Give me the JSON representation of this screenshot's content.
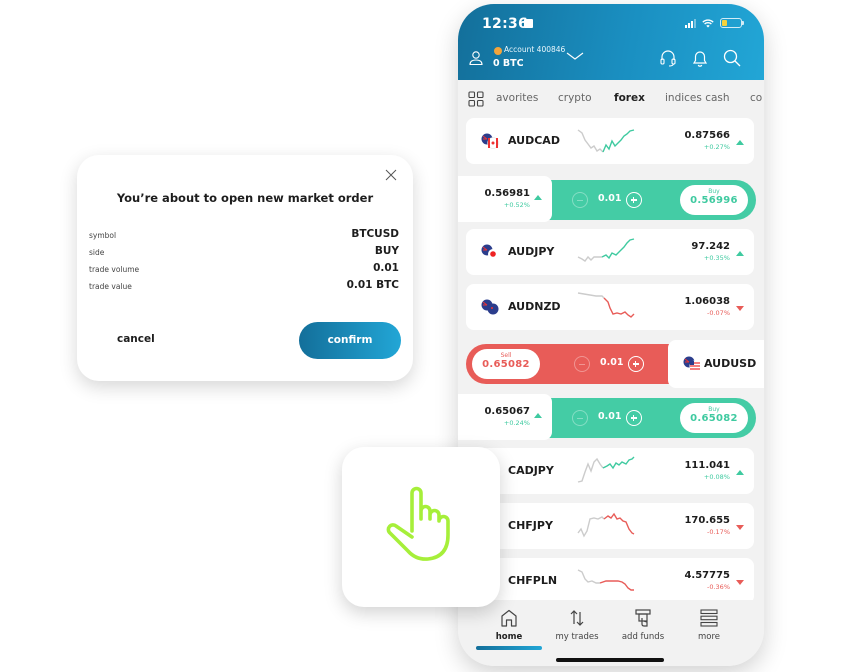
{
  "colors": {
    "brand_gradient_start": "#136f9a",
    "brand_gradient_end": "#22a6d6",
    "up": "#3fcaa0",
    "down": "#e85c58",
    "buy_bar": "#44cca5",
    "sell_bar": "#e85c58",
    "hand_icon": "#a6ef3a"
  },
  "status_bar": {
    "time": "12:36"
  },
  "account": {
    "label": "Account 400846",
    "balance": "0 BTC"
  },
  "header_icons": [
    "user-icon",
    "chevron-down-icon",
    "headset-icon",
    "bell-icon",
    "search-icon"
  ],
  "tabs": [
    {
      "label": "avorites",
      "active": false
    },
    {
      "label": "crypto",
      "active": false
    },
    {
      "label": "forex",
      "active": true
    },
    {
      "label": "indices cash",
      "active": false
    },
    {
      "label": "co",
      "active": false
    }
  ],
  "instruments": [
    {
      "symbol": "AUDCAD",
      "price": "0.87566",
      "change": "+0.27%",
      "dir": "up"
    },
    {
      "symbol": "AUDJPY",
      "price": "97.242",
      "change": "+0.35%",
      "dir": "up"
    },
    {
      "symbol": "AUDNZD",
      "price": "1.06038",
      "change": "-0.07%",
      "dir": "down"
    },
    {
      "symbol": "CADJPY",
      "price": "111.041",
      "change": "+0.08%",
      "dir": "up"
    },
    {
      "symbol": "CHFJPY",
      "price": "170.655",
      "change": "-0.17%",
      "dir": "down"
    },
    {
      "symbol": "CHFPLN",
      "price": "4.57775",
      "change": "-0.36%",
      "dir": "down"
    }
  ],
  "trade_rows": [
    {
      "side": "buy",
      "left_price": "0.56981",
      "left_change": "+0.52%",
      "volume": "0.01",
      "action_label": "Buy",
      "action_price": "0.56996"
    },
    {
      "side": "sell",
      "symbol": "AUDUSD",
      "volume": "0.01",
      "action_label": "Sell",
      "action_price": "0.65082"
    },
    {
      "side": "buy",
      "left_price": "0.65067",
      "left_change": "+0.24%",
      "volume": "0.01",
      "action_label": "Buy",
      "action_price": "0.65082"
    }
  ],
  "bottom_nav": [
    {
      "label": "home",
      "icon": "home-icon",
      "active": true
    },
    {
      "label": "my trades",
      "icon": "arrows-updown-icon",
      "active": false
    },
    {
      "label": "add funds",
      "icon": "atm-icon",
      "active": false
    },
    {
      "label": "more",
      "icon": "menu-icon",
      "active": false
    }
  ],
  "dialog": {
    "title": "You’re about to open new market order",
    "fields": [
      {
        "key": "symbol",
        "value": "BTCUSD"
      },
      {
        "key": "side",
        "value": "BUY"
      },
      {
        "key": "trade volume",
        "value": "0.01"
      },
      {
        "key": "trade value",
        "value": "0.01 BTC"
      }
    ],
    "cancel_label": "cancel",
    "confirm_label": "confirm"
  }
}
